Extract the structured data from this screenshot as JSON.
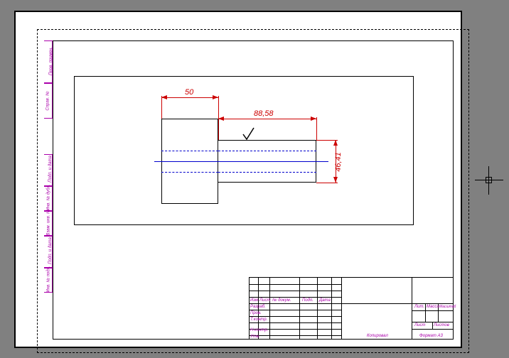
{
  "dimensions": {
    "dim1": "50",
    "dim2": "88,58",
    "dim3": "46,41"
  },
  "side_labels": {
    "s1": "Перв. примен.",
    "s2": "Справ. №",
    "s3": "Подп. и дата",
    "s4": "Инв. № дубл.",
    "s5": "Взам. инв. №",
    "s6": "Подп. и дата",
    "s7": "Инв. № подл."
  },
  "title_block": {
    "izm": "Изм",
    "list": "Лист",
    "ndokum": "№ докум.",
    "podp": "Подп.",
    "data": "Дата",
    "razrab": "Разраб.",
    "prov": "Пров.",
    "tkontr": "Т.контр.",
    "nkontr": "Н.контр.",
    "utv": "Утв.",
    "lit": "Лит.",
    "massa": "Масса",
    "masshtab": "Масштаб",
    "list2": "Лист",
    "listov": "Листов",
    "kopiroval": "Копировал",
    "format": "Формат А3"
  }
}
